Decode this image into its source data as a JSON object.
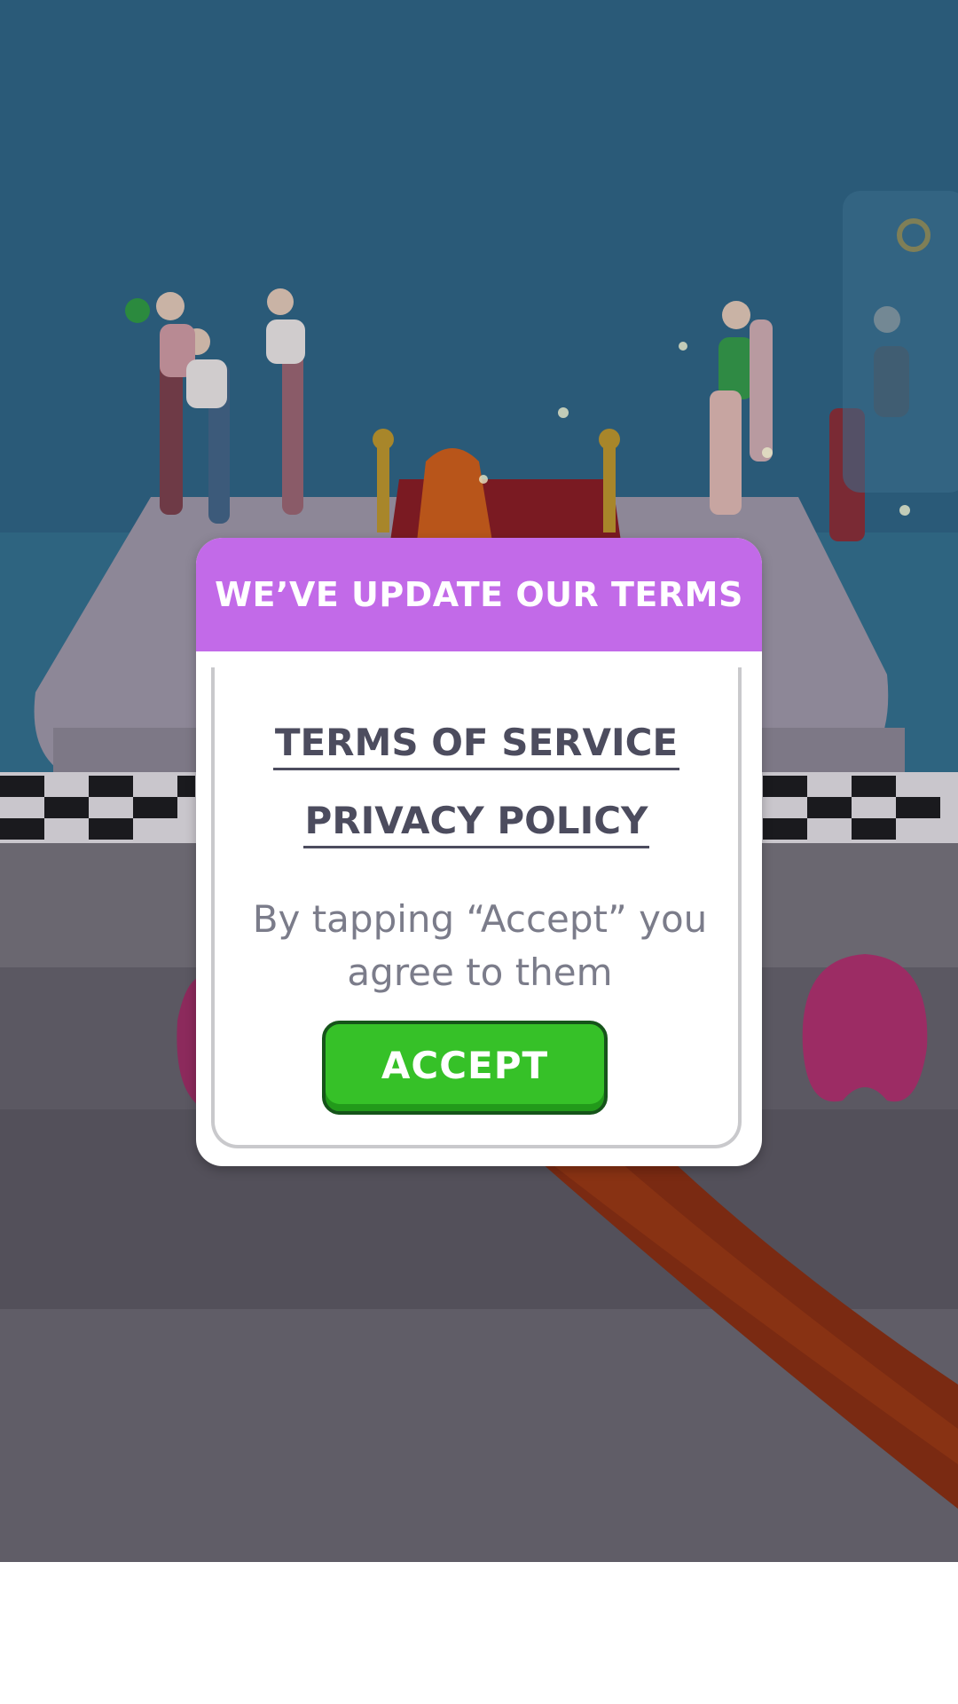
{
  "dialog": {
    "title": "WE’VE UPDATE OUR TERMS",
    "terms_link": "TERMS OF SERVICE",
    "privacy_link": "PRIVACY POLICY",
    "consent_line_1": "By tapping “Accept” you",
    "consent_line_2": "agree to them",
    "accept_label": "ACCEPT"
  },
  "colors": {
    "header": "#c26ae8",
    "accept_button": "#36c128",
    "link_text": "#4c4c5e",
    "body_text": "#7b7c8a",
    "sky": "#2a5a78"
  }
}
